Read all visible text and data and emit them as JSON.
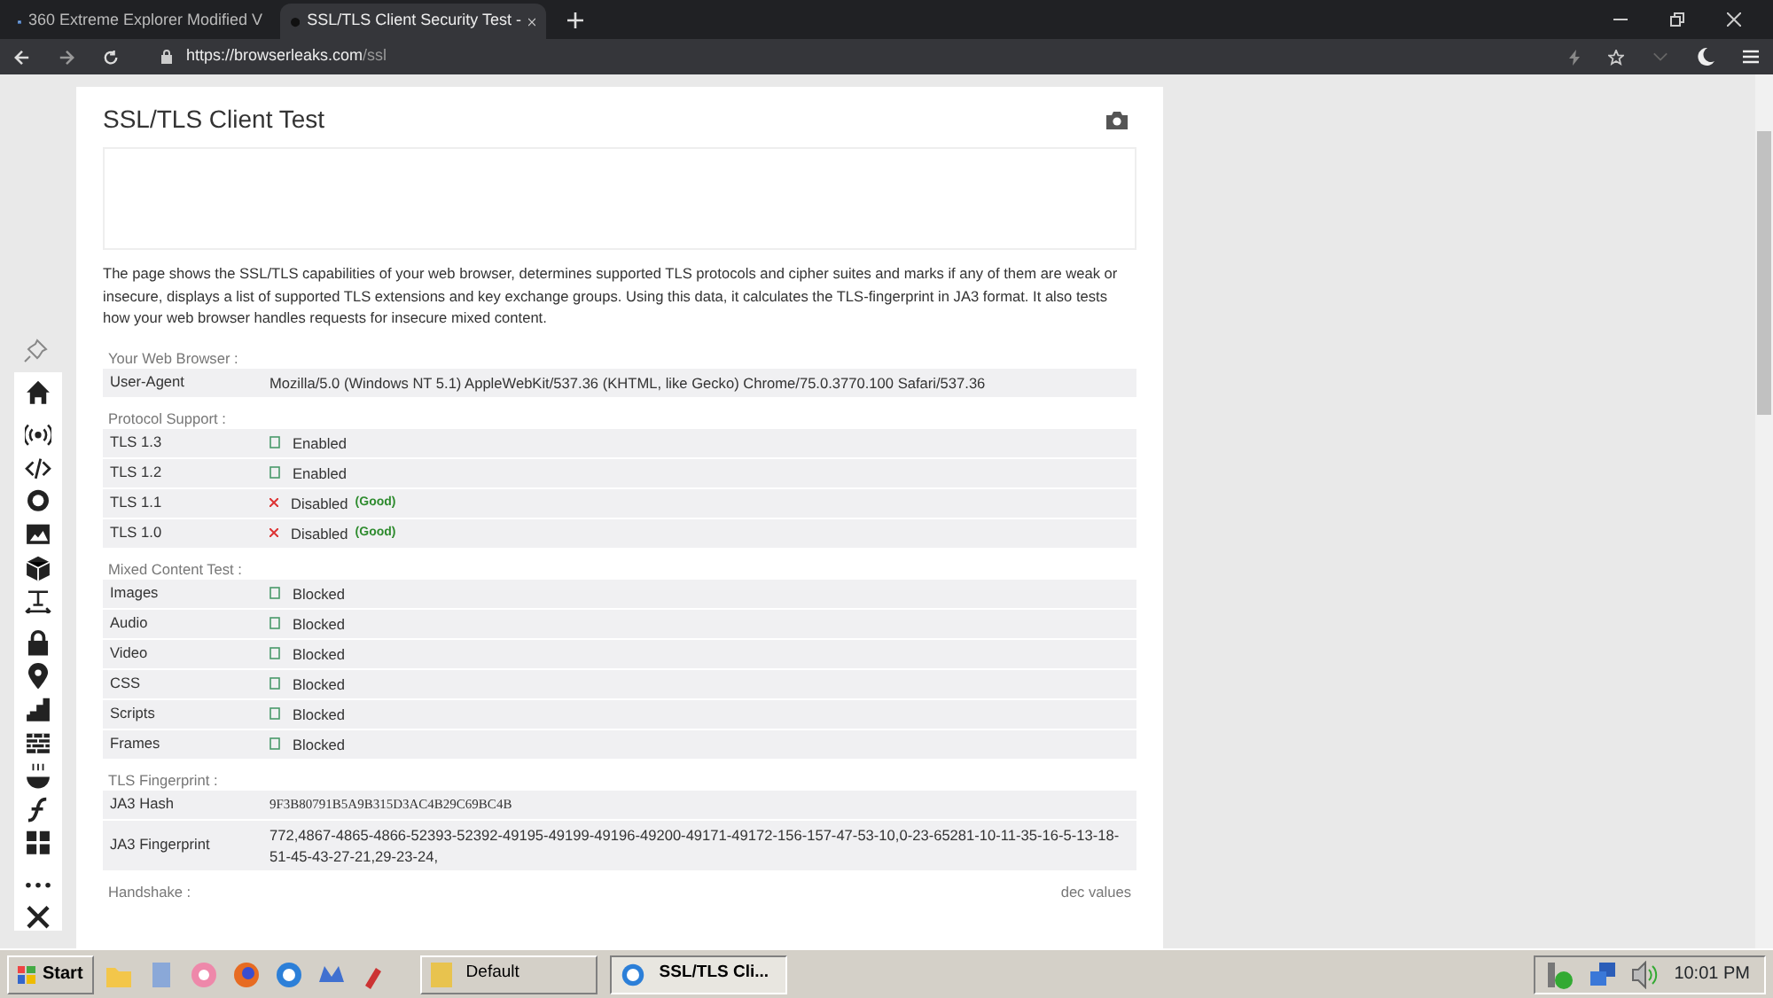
{
  "browser": {
    "tabs": [
      {
        "title": "360 Extreme Explorer Modified V",
        "selected": false
      },
      {
        "title": "SSL/TLS Client Security Test -",
        "selected": true
      }
    ],
    "url_host": "https://browserleaks.com",
    "url_path": "/ssl"
  },
  "page": {
    "title": "SSL/TLS Client Test",
    "intro": "The page shows the SSL/TLS capabilities of your web browser, determines supported TLS protocols and cipher suites and marks if any of them are weak or insecure, displays a list of supported TLS extensions and key exchange groups. Using this data, it calculates the TLS-fingerprint in JA3 format. It also tests how your web browser handles requests for insecure mixed content.",
    "sections": [
      {
        "heading": "Your Web Browser :",
        "rows": [
          {
            "label": "User-Agent",
            "value": "Mozilla/5.0 (Windows NT 5.1) AppleWebKit/537.36 (KHTML, like Gecko) Chrome/75.0.3770.100 Safari/537.36",
            "kind": "text"
          }
        ]
      },
      {
        "heading": "Protocol Support :",
        "rows": [
          {
            "label": "TLS 1.3",
            "value": "Enabled",
            "kind": "ok"
          },
          {
            "label": "TLS 1.2",
            "value": "Enabled",
            "kind": "ok"
          },
          {
            "label": "TLS 1.1",
            "value": "Disabled",
            "kind": "bad",
            "note": "(Good)"
          },
          {
            "label": "TLS 1.0",
            "value": "Disabled",
            "kind": "bad",
            "note": "(Good)"
          }
        ]
      },
      {
        "heading": "Mixed Content Test :",
        "rows": [
          {
            "label": "Images",
            "value": "Blocked",
            "kind": "ok"
          },
          {
            "label": "Audio",
            "value": "Blocked",
            "kind": "ok"
          },
          {
            "label": "Video",
            "value": "Blocked",
            "kind": "ok"
          },
          {
            "label": "CSS",
            "value": "Blocked",
            "kind": "ok"
          },
          {
            "label": "Scripts",
            "value": "Blocked",
            "kind": "ok"
          },
          {
            "label": "Frames",
            "value": "Blocked",
            "kind": "ok"
          }
        ]
      },
      {
        "heading": "TLS Fingerprint :",
        "rows": [
          {
            "label": "JA3 Hash",
            "value": "9F3B80791B5A9B315D3AC4B29C69BC4B",
            "kind": "hash"
          },
          {
            "label": "JA3 Fingerprint",
            "value": "772,4867-4865-4866-52393-52392-49195-49199-49196-49200-49171-49172-156-157-47-53-10,0-23-65281-10-11-35-16-5-13-18-51-45-43-27-21,29-23-24,",
            "kind": "text"
          }
        ]
      },
      {
        "heading": "Handshake :",
        "aside": "dec values"
      }
    ]
  },
  "taskbar": {
    "start": "Start",
    "windows": [
      {
        "title": "Default",
        "selected": false
      },
      {
        "title": "SSL/TLS Cli...",
        "selected": true
      }
    ],
    "clock": "10:01 PM"
  }
}
